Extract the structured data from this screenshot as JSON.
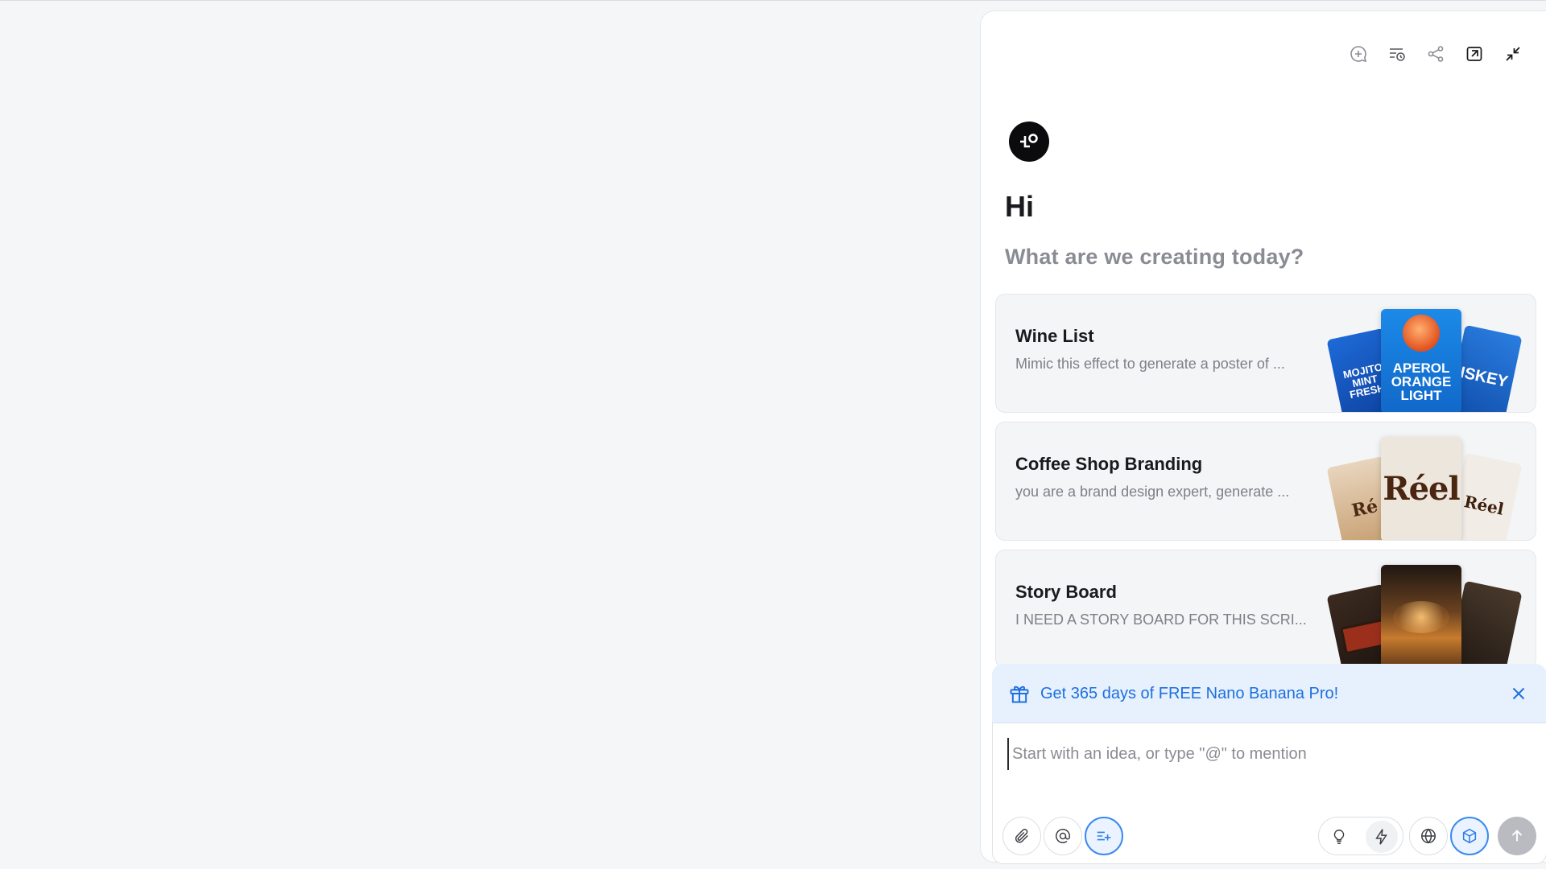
{
  "header": {
    "icons": [
      "new-chat-icon",
      "history-icon",
      "share-icon",
      "collapse-panel-icon",
      "minimize-icon"
    ]
  },
  "welcome": {
    "greeting": "Hi",
    "prompt": "What are we creating today?"
  },
  "templates": [
    {
      "title": "Wine List",
      "description": "Mimic this effect to generate a poster of ...",
      "thumb_left": "MOJITO MINT FRESH",
      "thumb_center": "APEROL ORANGE LIGHT",
      "thumb_right": "ISKEY"
    },
    {
      "title": "Coffee Shop Branding",
      "description": "you are a brand design expert, generate ...",
      "thumb_left": "Ré",
      "thumb_center": "Réel",
      "thumb_right": "Réel"
    },
    {
      "title": "Story Board",
      "description": "I NEED A STORY BOARD FOR THIS SCRI..."
    }
  ],
  "promo": {
    "text": "Get 365 days of FREE Nano Banana Pro!",
    "icon": "gift-icon",
    "color": "#1e6fe0"
  },
  "composer": {
    "placeholder": "Start with an idea, or type \"@\" to mention",
    "value": "",
    "left_tools": [
      "attach-icon",
      "mention-icon",
      "prompt-enhance-icon"
    ],
    "right_tools": [
      "idea-icon",
      "fast-mode-icon",
      "web-search-icon",
      "3d-model-icon",
      "send-icon"
    ]
  },
  "colors": {
    "accent": "#3a8af0",
    "promo_bg": "#e6f1fd",
    "send_disabled": "#b9bbc0"
  }
}
